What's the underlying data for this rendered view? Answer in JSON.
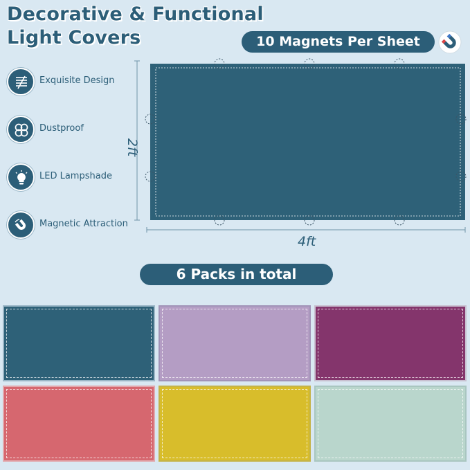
{
  "title": {
    "line1": "Decorative & Functional",
    "line2": "Light Covers"
  },
  "magnets_label": "10 Magnets Per Sheet",
  "features": [
    {
      "label": "Exquisite Design",
      "icon": "pattern-icon"
    },
    {
      "label": "Dustproof",
      "icon": "clover-icon"
    },
    {
      "label": "LED Lampshade",
      "icon": "light-bulb-icon"
    },
    {
      "label": "Magnetic Attraction",
      "icon": "magnet-icon"
    }
  ],
  "sheet": {
    "height_label": "2ft",
    "width_label": "4ft",
    "color": "#2e6178",
    "magnet_count": 10
  },
  "packs_label": "6 Packs in total",
  "colors": {
    "accent": "#2c5e78",
    "background": "#d9e8f2"
  },
  "swatches": [
    {
      "name": "teal",
      "color": "#2e6178",
      "border": "#9ab6c6"
    },
    {
      "name": "lavender",
      "color": "#b49dc4",
      "border": "#a294b8"
    },
    {
      "name": "plum",
      "color": "#84356c",
      "border": "#c8c0d0"
    },
    {
      "name": "coral",
      "color": "#d6676f",
      "border": "#e2a7ac"
    },
    {
      "name": "yellow",
      "color": "#d8bd2b",
      "border": "#c4b34a"
    },
    {
      "name": "mint",
      "color": "#b9d6cc",
      "border": "#a9c6c0"
    }
  ]
}
